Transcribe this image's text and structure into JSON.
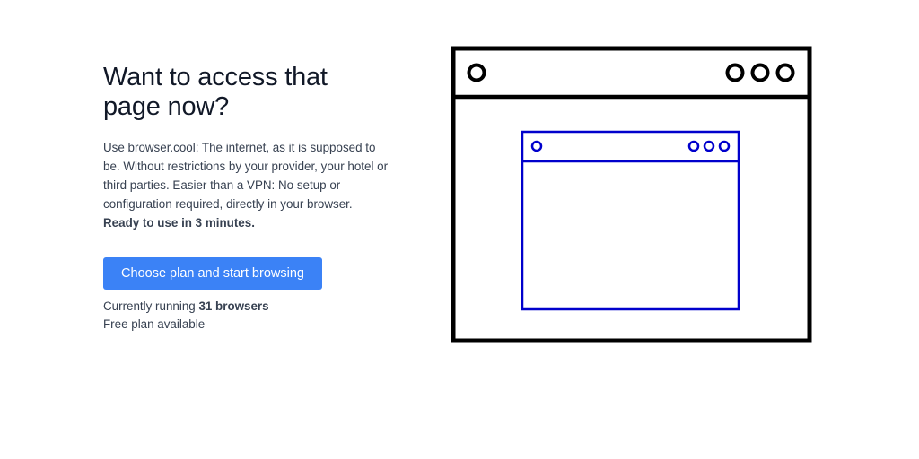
{
  "hero": {
    "headline": "Want to access that page now?",
    "description": "Use browser.cool: The internet, as it is supposed to be. Without restrictions by your provider, your hotel or third parties. Easier than a VPN: No setup or configuration required, directly in your browser.",
    "description_bold": "Ready to use in 3 minutes.",
    "cta_label": "Choose plan and start browsing",
    "running_prefix": "Currently running ",
    "running_count": "31 browsers",
    "free_plan": "Free plan available"
  },
  "illustration": {
    "outer_icon": "browser-window-icon",
    "inner_icon": "nested-browser-window-icon",
    "colors": {
      "outer_stroke": "#000000",
      "inner_stroke": "#0000cc"
    }
  },
  "colors": {
    "accent": "#3b82f6",
    "heading": "#111827",
    "body_text": "#374151"
  }
}
